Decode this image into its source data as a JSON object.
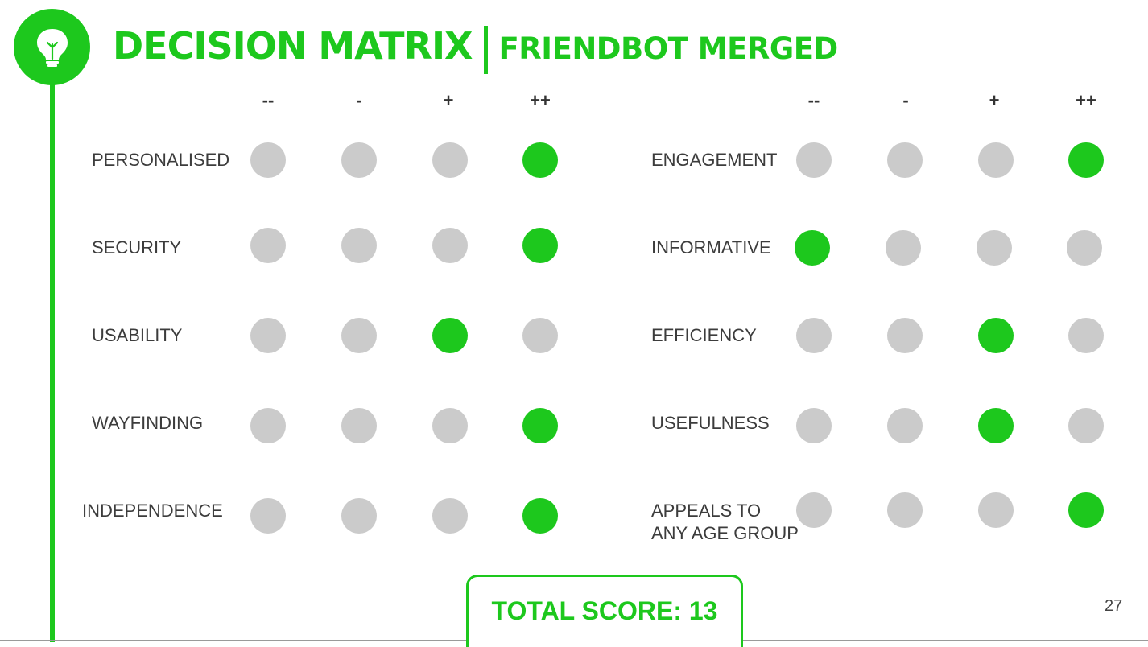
{
  "title": {
    "main": "DECISION MATRIX",
    "sub": "FRIENDBOT MERGED"
  },
  "scale_headers": [
    "--",
    "-",
    "+",
    "++"
  ],
  "left_criteria": [
    {
      "label": "PERSONALISED",
      "rating": "++"
    },
    {
      "label": "SECURITY",
      "rating": "++"
    },
    {
      "label": "USABILITY",
      "rating": "+"
    },
    {
      "label": "WAYFINDING",
      "rating": "++"
    },
    {
      "label": "INDEPENDENCE",
      "rating": "++"
    }
  ],
  "right_criteria": [
    {
      "label": "ENGAGEMENT",
      "rating": "++"
    },
    {
      "label": "INFORMATIVE",
      "rating": "--"
    },
    {
      "label": "EFFICIENCY",
      "rating": "+"
    },
    {
      "label": "USEFULNESS",
      "rating": "+"
    },
    {
      "label": "APPEALS TO ANY AGE GROUP",
      "label_lines": [
        "APPEALS TO",
        "ANY AGE GROUP"
      ],
      "rating": "++"
    }
  ],
  "total_score": "TOTAL SCORE: 13",
  "page_number": "27",
  "colors": {
    "accent": "#1dc81d",
    "inactive": "#cbcbcb",
    "text": "#3c3c3c"
  },
  "icons": {
    "logo": "lightbulb-icon"
  }
}
